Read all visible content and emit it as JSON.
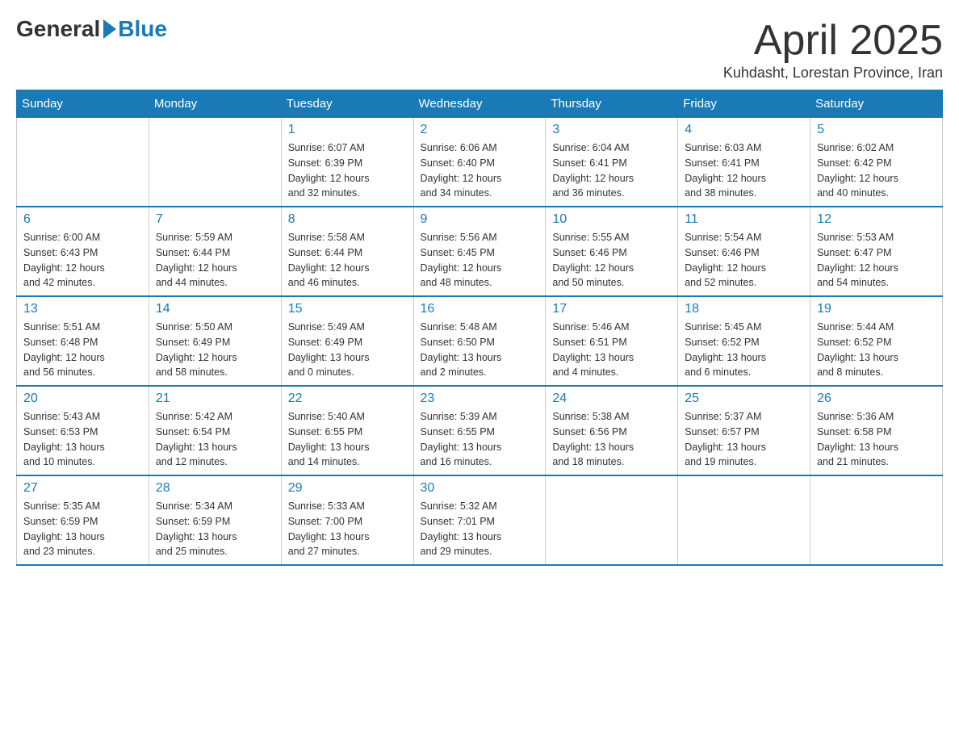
{
  "header": {
    "logo_general": "General",
    "logo_blue": "Blue",
    "month_title": "April 2025",
    "subtitle": "Kuhdasht, Lorestan Province, Iran"
  },
  "weekdays": [
    "Sunday",
    "Monday",
    "Tuesday",
    "Wednesday",
    "Thursday",
    "Friday",
    "Saturday"
  ],
  "weeks": [
    [
      {
        "day": "",
        "info": ""
      },
      {
        "day": "",
        "info": ""
      },
      {
        "day": "1",
        "info": "Sunrise: 6:07 AM\nSunset: 6:39 PM\nDaylight: 12 hours\nand 32 minutes."
      },
      {
        "day": "2",
        "info": "Sunrise: 6:06 AM\nSunset: 6:40 PM\nDaylight: 12 hours\nand 34 minutes."
      },
      {
        "day": "3",
        "info": "Sunrise: 6:04 AM\nSunset: 6:41 PM\nDaylight: 12 hours\nand 36 minutes."
      },
      {
        "day": "4",
        "info": "Sunrise: 6:03 AM\nSunset: 6:41 PM\nDaylight: 12 hours\nand 38 minutes."
      },
      {
        "day": "5",
        "info": "Sunrise: 6:02 AM\nSunset: 6:42 PM\nDaylight: 12 hours\nand 40 minutes."
      }
    ],
    [
      {
        "day": "6",
        "info": "Sunrise: 6:00 AM\nSunset: 6:43 PM\nDaylight: 12 hours\nand 42 minutes."
      },
      {
        "day": "7",
        "info": "Sunrise: 5:59 AM\nSunset: 6:44 PM\nDaylight: 12 hours\nand 44 minutes."
      },
      {
        "day": "8",
        "info": "Sunrise: 5:58 AM\nSunset: 6:44 PM\nDaylight: 12 hours\nand 46 minutes."
      },
      {
        "day": "9",
        "info": "Sunrise: 5:56 AM\nSunset: 6:45 PM\nDaylight: 12 hours\nand 48 minutes."
      },
      {
        "day": "10",
        "info": "Sunrise: 5:55 AM\nSunset: 6:46 PM\nDaylight: 12 hours\nand 50 minutes."
      },
      {
        "day": "11",
        "info": "Sunrise: 5:54 AM\nSunset: 6:46 PM\nDaylight: 12 hours\nand 52 minutes."
      },
      {
        "day": "12",
        "info": "Sunrise: 5:53 AM\nSunset: 6:47 PM\nDaylight: 12 hours\nand 54 minutes."
      }
    ],
    [
      {
        "day": "13",
        "info": "Sunrise: 5:51 AM\nSunset: 6:48 PM\nDaylight: 12 hours\nand 56 minutes."
      },
      {
        "day": "14",
        "info": "Sunrise: 5:50 AM\nSunset: 6:49 PM\nDaylight: 12 hours\nand 58 minutes."
      },
      {
        "day": "15",
        "info": "Sunrise: 5:49 AM\nSunset: 6:49 PM\nDaylight: 13 hours\nand 0 minutes."
      },
      {
        "day": "16",
        "info": "Sunrise: 5:48 AM\nSunset: 6:50 PM\nDaylight: 13 hours\nand 2 minutes."
      },
      {
        "day": "17",
        "info": "Sunrise: 5:46 AM\nSunset: 6:51 PM\nDaylight: 13 hours\nand 4 minutes."
      },
      {
        "day": "18",
        "info": "Sunrise: 5:45 AM\nSunset: 6:52 PM\nDaylight: 13 hours\nand 6 minutes."
      },
      {
        "day": "19",
        "info": "Sunrise: 5:44 AM\nSunset: 6:52 PM\nDaylight: 13 hours\nand 8 minutes."
      }
    ],
    [
      {
        "day": "20",
        "info": "Sunrise: 5:43 AM\nSunset: 6:53 PM\nDaylight: 13 hours\nand 10 minutes."
      },
      {
        "day": "21",
        "info": "Sunrise: 5:42 AM\nSunset: 6:54 PM\nDaylight: 13 hours\nand 12 minutes."
      },
      {
        "day": "22",
        "info": "Sunrise: 5:40 AM\nSunset: 6:55 PM\nDaylight: 13 hours\nand 14 minutes."
      },
      {
        "day": "23",
        "info": "Sunrise: 5:39 AM\nSunset: 6:55 PM\nDaylight: 13 hours\nand 16 minutes."
      },
      {
        "day": "24",
        "info": "Sunrise: 5:38 AM\nSunset: 6:56 PM\nDaylight: 13 hours\nand 18 minutes."
      },
      {
        "day": "25",
        "info": "Sunrise: 5:37 AM\nSunset: 6:57 PM\nDaylight: 13 hours\nand 19 minutes."
      },
      {
        "day": "26",
        "info": "Sunrise: 5:36 AM\nSunset: 6:58 PM\nDaylight: 13 hours\nand 21 minutes."
      }
    ],
    [
      {
        "day": "27",
        "info": "Sunrise: 5:35 AM\nSunset: 6:59 PM\nDaylight: 13 hours\nand 23 minutes."
      },
      {
        "day": "28",
        "info": "Sunrise: 5:34 AM\nSunset: 6:59 PM\nDaylight: 13 hours\nand 25 minutes."
      },
      {
        "day": "29",
        "info": "Sunrise: 5:33 AM\nSunset: 7:00 PM\nDaylight: 13 hours\nand 27 minutes."
      },
      {
        "day": "30",
        "info": "Sunrise: 5:32 AM\nSunset: 7:01 PM\nDaylight: 13 hours\nand 29 minutes."
      },
      {
        "day": "",
        "info": ""
      },
      {
        "day": "",
        "info": ""
      },
      {
        "day": "",
        "info": ""
      }
    ]
  ]
}
